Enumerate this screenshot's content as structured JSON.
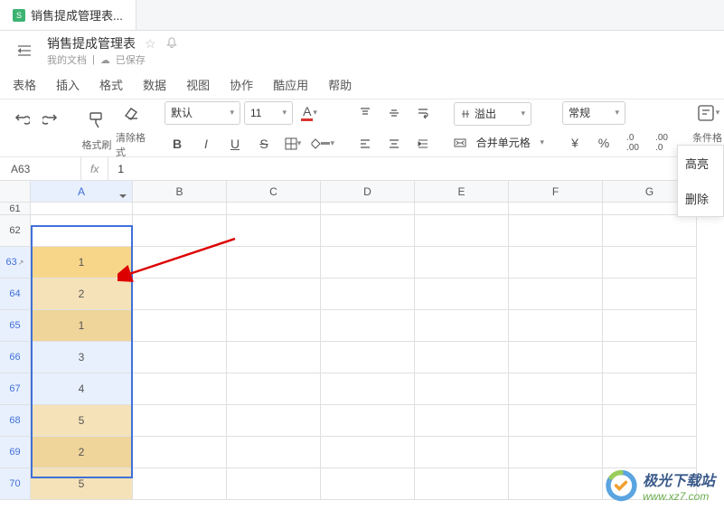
{
  "tab": {
    "name": "销售提成管理表..."
  },
  "doc": {
    "title": "销售提成管理表",
    "location": "我的文档",
    "save_status": "已保存"
  },
  "menu": {
    "items": [
      "表格",
      "插入",
      "格式",
      "数据",
      "视图",
      "协作",
      "酷应用",
      "帮助"
    ]
  },
  "toolbar": {
    "brush": "格式刷",
    "clear": "清除格式",
    "font_name": "默认",
    "font_size": "11",
    "overflow": "溢出",
    "merge": "合并单元格",
    "number_format": "常规",
    "cond_format": "条件格式"
  },
  "formula_bar": {
    "cell_ref": "A63",
    "fx": "fx",
    "value": "1"
  },
  "columns": [
    "A",
    "B",
    "C",
    "D",
    "E",
    "F",
    "G"
  ],
  "rows": [
    {
      "num": "61",
      "a": "",
      "class": "",
      "active": false,
      "tall": false
    },
    {
      "num": "62",
      "a": "",
      "class": "",
      "active": false,
      "tall": true
    },
    {
      "num": "63",
      "a": "1",
      "class": "first-sel",
      "active": true,
      "tall": true
    },
    {
      "num": "64",
      "a": "2",
      "class": "dup",
      "active": true,
      "tall": true
    },
    {
      "num": "65",
      "a": "1",
      "class": "dup-dark",
      "active": true,
      "tall": true
    },
    {
      "num": "66",
      "a": "3",
      "class": "selected",
      "active": true,
      "tall": true
    },
    {
      "num": "67",
      "a": "4",
      "class": "selected",
      "active": true,
      "tall": true
    },
    {
      "num": "68",
      "a": "5",
      "class": "dup",
      "active": true,
      "tall": true
    },
    {
      "num": "69",
      "a": "2",
      "class": "dup-dark",
      "active": true,
      "tall": true
    },
    {
      "num": "70",
      "a": "5",
      "class": "dup",
      "active": true,
      "tall": true
    }
  ],
  "context_menu": {
    "highlight": "高亮",
    "delete": "删除"
  },
  "watermark": {
    "cn": "极光下载站",
    "url": "www.xz7.com"
  }
}
